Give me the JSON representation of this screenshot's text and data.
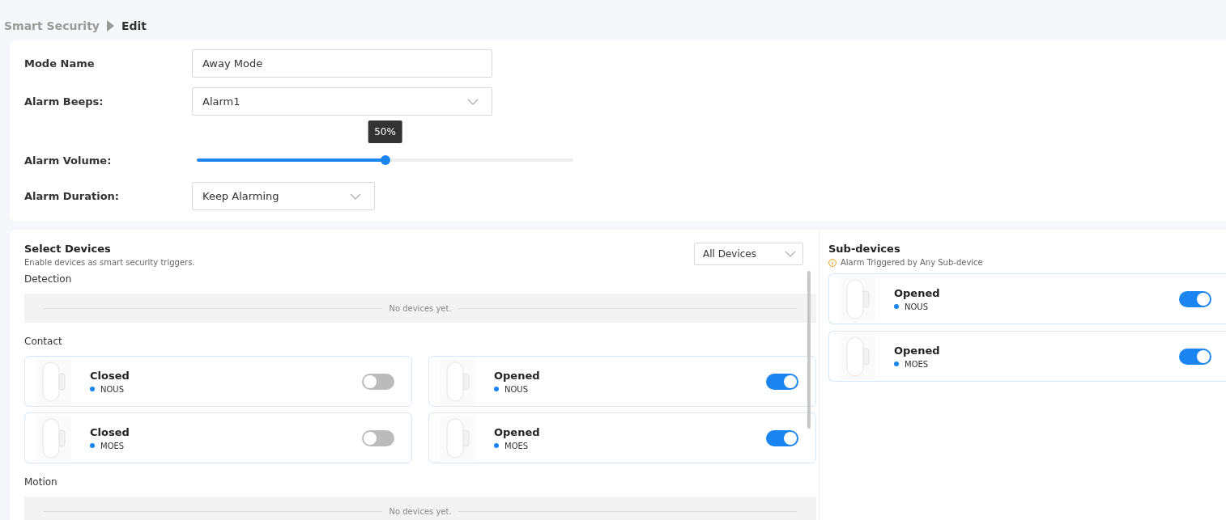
{
  "breadcrumb": {
    "parent": "Smart Security",
    "current": "Edit"
  },
  "settings": {
    "mode_name": {
      "label": "Mode Name",
      "value": "Away Mode"
    },
    "alarm_beeps": {
      "label": "Alarm Beeps:",
      "value": "Alarm1"
    },
    "alarm_volume": {
      "label": "Alarm Volume:",
      "level": 0.5,
      "tooltip": "50%"
    },
    "alarm_duration": {
      "label": "Alarm Duration:",
      "value": "Keep Alarming"
    }
  },
  "select_devices": {
    "title": "Select Devices",
    "subtitle": "Enable devices as smart security triggers.",
    "filter": "All Devices",
    "sections": [
      {
        "title": "Detection",
        "kind": "empty",
        "empty_text": "No devices yet."
      },
      {
        "title": "Contact",
        "kind": "devices",
        "devices": [
          {
            "name": "Closed",
            "brand": "NOUS",
            "on": false
          },
          {
            "name": "Opened",
            "brand": "NOUS",
            "on": true
          },
          {
            "name": "Closed",
            "brand": "MOES",
            "on": false
          },
          {
            "name": "Opened",
            "brand": "MOES",
            "on": true
          }
        ]
      },
      {
        "title": "Motion",
        "kind": "empty",
        "empty_text": "No devices yet."
      }
    ]
  },
  "sub_devices": {
    "title": "Sub-devices",
    "note": "Alarm Triggered by Any Sub-device",
    "devices": [
      {
        "name": "Opened",
        "brand": "NOUS",
        "on": true
      },
      {
        "name": "Opened",
        "brand": "MOES",
        "on": true
      }
    ]
  }
}
